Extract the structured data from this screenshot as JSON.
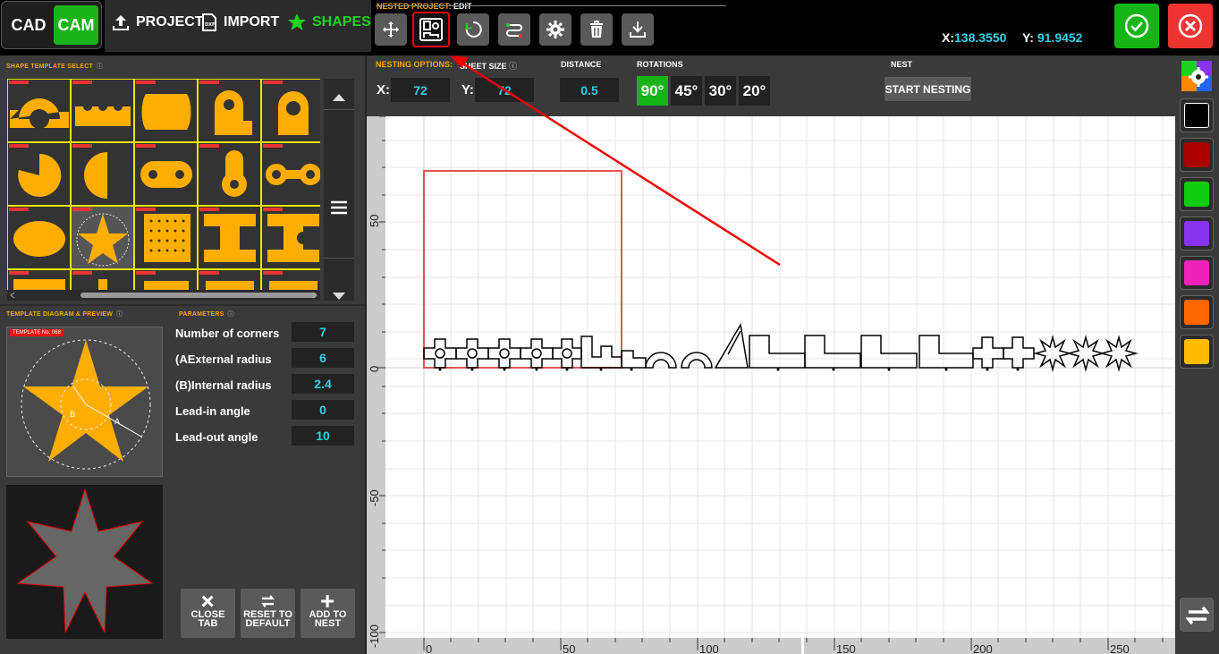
{
  "topbar": {
    "cad_label": "CAD",
    "cam_label": "CAM",
    "project_label": "PROJECT",
    "import_label": "IMPORT",
    "shapes_label": "SHAPES",
    "nested_project_label": "NESTED PROJECT:",
    "nested_project_mode": "EDIT",
    "tools": [
      "move-icon",
      "nest-layout-icon",
      "rotate-icon",
      "reorder-icon",
      "gear-icon",
      "trash-icon",
      "download-icon"
    ],
    "coord_x_label": "X:",
    "coord_x": "138.3550",
    "coord_y_label": "Y:",
    "coord_y": "91.9452"
  },
  "left": {
    "template_select_title": "SHAPE TEMPLATE SELECT",
    "diagram_title": "TEMPLATE DIAGRAM & PREVIEW",
    "parameters_title": "PARAMETERS",
    "template_no": "TEMPLATE No. 068",
    "diagram_label_a": "A",
    "diagram_label_b": "B",
    "params": [
      {
        "label": "Number of corners",
        "value": "7"
      },
      {
        "label": "(AExternal radius",
        "value": "6"
      },
      {
        "label": "(B)Internal radius",
        "value": "2.4"
      },
      {
        "label": "Lead-in angle",
        "value": "0"
      },
      {
        "label": "Lead-out angle",
        "value": "10"
      }
    ],
    "close_tab": "CLOSE TAB",
    "reset": "RESET TO DEFAULT",
    "add_to_nest": "ADD TO NEST"
  },
  "nest_options": {
    "title": "NESTING OPTIONS:",
    "sheet_size": "SHEET SIZE",
    "distance_title": "DISTANCE",
    "rotations_title": "ROTATIONS",
    "nest_title": "NEST",
    "x_label": "X:",
    "x_value": "72",
    "y_label": "Y:",
    "y_value": "72",
    "distance": "0.5",
    "rotations": [
      "90°",
      "45°",
      "30°",
      "20°"
    ],
    "active_rotation": "90°",
    "start": "START NESTING"
  },
  "rulers": {
    "left": [
      "50",
      "0",
      "-50",
      "-100"
    ],
    "bottom": [
      "0",
      "50",
      "100",
      "150",
      "200",
      "250"
    ]
  },
  "palette": {
    "colors": [
      "#000000",
      "#aa0000",
      "#11cc11",
      "#8833ee",
      "#ee22bb",
      "#ff6600",
      "#ffbb00"
    ]
  },
  "colors": {
    "accent_green": "#15b515",
    "accent_red": "#e33333",
    "label_orange": "#f0a800",
    "value_cyan": "#2ed0e6",
    "shape_yellow": "#ffae00"
  }
}
